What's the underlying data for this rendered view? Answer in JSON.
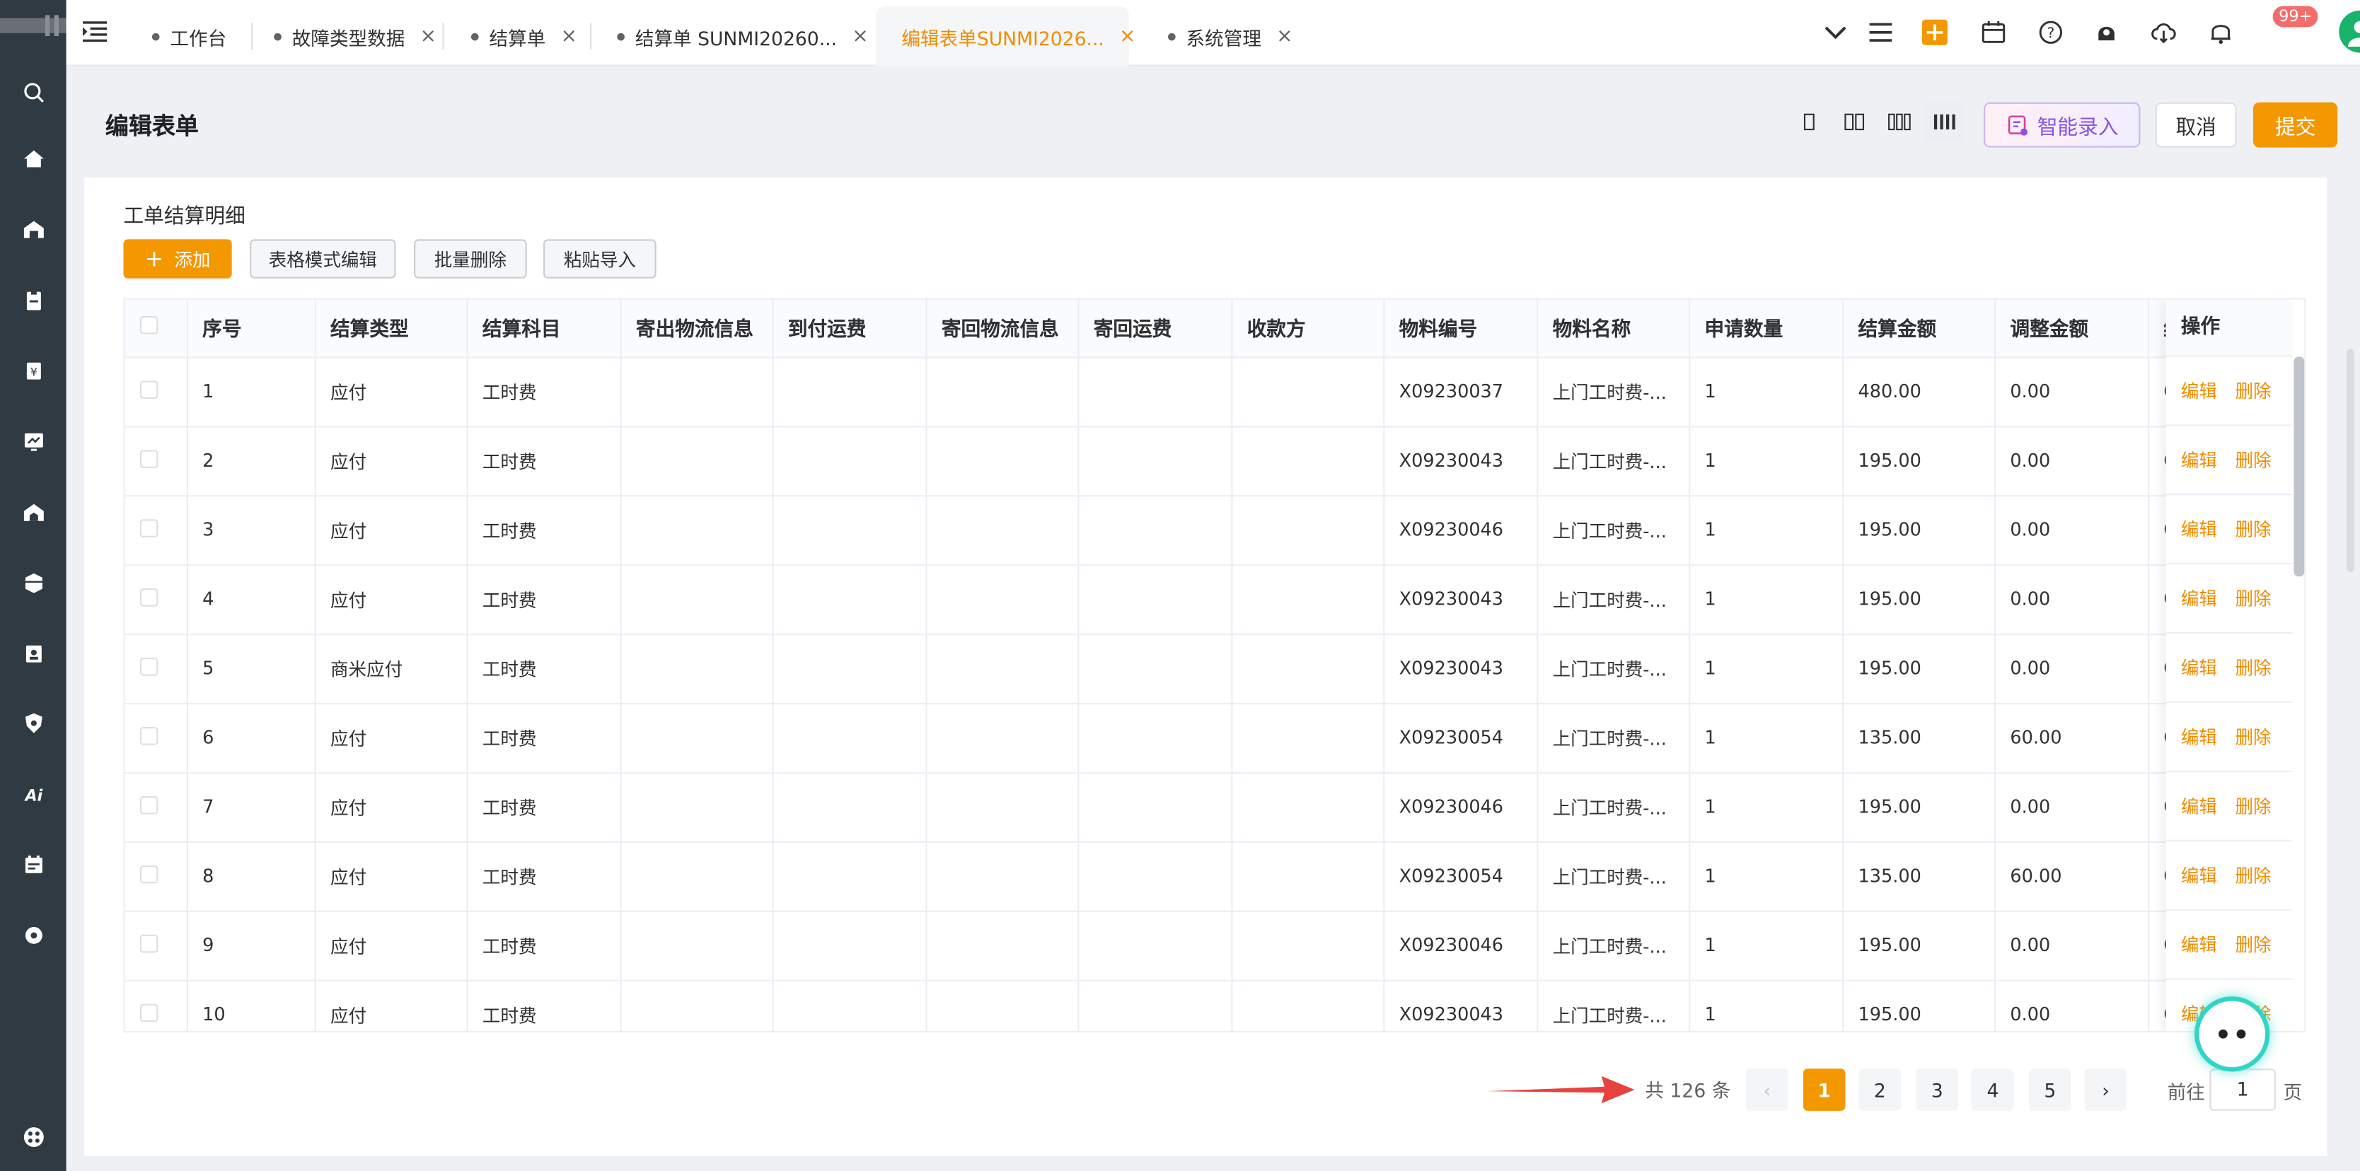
{
  "tabs": [
    {
      "label": "工作台",
      "closable": false
    },
    {
      "label": "故障类型数据",
      "closable": true
    },
    {
      "label": "结算单",
      "closable": true
    },
    {
      "label": "结算单 SUNMI20260...",
      "closable": true
    },
    {
      "label": "编辑表单SUNMI2026...",
      "closable": true,
      "active": true
    },
    {
      "label": "系统管理",
      "closable": true
    }
  ],
  "topbar": {
    "notification_badge": "99+",
    "icons": [
      "chevron-down-icon",
      "menu-lines-icon",
      "plus-square-icon",
      "calendar-icon",
      "help-icon",
      "bell-user-icon",
      "cloud-download-icon",
      "bell-icon",
      "user-avatar"
    ]
  },
  "header": {
    "title": "编辑表单",
    "ai_button": "智能录入",
    "cancel_button": "取消",
    "submit_button": "提交"
  },
  "section": {
    "title": "工单结算明细",
    "add_button": "添加",
    "table_mode_button": "表格模式编辑",
    "batch_delete_button": "批量删除",
    "paste_import_button": "粘贴导入"
  },
  "table": {
    "columns": [
      "序号",
      "结算类型",
      "结算科目",
      "寄出物流信息",
      "到付运费",
      "寄回物流信息",
      "寄回运费",
      "收款方",
      "物料编号",
      "物料名称",
      "申请数量",
      "结算金额",
      "调整金额",
      "结"
    ],
    "action_header": "操作",
    "action_edit": "编辑",
    "action_delete": "删除",
    "rows": [
      [
        "1",
        "应付",
        "工时费",
        "",
        "",
        "",
        "",
        "",
        "X09230037",
        "上门工时费-...",
        "1",
        "480.00",
        "0.00",
        "C"
      ],
      [
        "2",
        "应付",
        "工时费",
        "",
        "",
        "",
        "",
        "",
        "X09230043",
        "上门工时费-...",
        "1",
        "195.00",
        "0.00",
        "C"
      ],
      [
        "3",
        "应付",
        "工时费",
        "",
        "",
        "",
        "",
        "",
        "X09230046",
        "上门工时费-...",
        "1",
        "195.00",
        "0.00",
        "CN"
      ],
      [
        "4",
        "应付",
        "工时费",
        "",
        "",
        "",
        "",
        "",
        "X09230043",
        "上门工时费-...",
        "1",
        "195.00",
        "0.00",
        "CN"
      ],
      [
        "5",
        "商米应付",
        "工时费",
        "",
        "",
        "",
        "",
        "",
        "X09230043",
        "上门工时费-...",
        "1",
        "195.00",
        "0.00",
        "CN"
      ],
      [
        "6",
        "应付",
        "工时费",
        "",
        "",
        "",
        "",
        "",
        "X09230054",
        "上门工时费-...",
        "1",
        "135.00",
        "60.00",
        "C"
      ],
      [
        "7",
        "应付",
        "工时费",
        "",
        "",
        "",
        "",
        "",
        "X09230046",
        "上门工时费-...",
        "1",
        "195.00",
        "0.00",
        "C"
      ],
      [
        "8",
        "应付",
        "工时费",
        "",
        "",
        "",
        "",
        "",
        "X09230054",
        "上门工时费-...",
        "1",
        "135.00",
        "60.00",
        "C"
      ],
      [
        "9",
        "应付",
        "工时费",
        "",
        "",
        "",
        "",
        "",
        "X09230046",
        "上门工时费-...",
        "1",
        "195.00",
        "0.00",
        "C"
      ],
      [
        "10",
        "应付",
        "工时费",
        "",
        "",
        "",
        "",
        "",
        "X09230043",
        "上门工时费-...",
        "1",
        "195.00",
        "0.00",
        "C"
      ]
    ]
  },
  "pagination": {
    "total_text": "共 126 条",
    "pages": [
      "1",
      "2",
      "3",
      "4",
      "5"
    ],
    "current_page": "1",
    "prev": "‹",
    "next": "›",
    "goto_label": "前往",
    "goto_value": "1",
    "goto_unit": "页"
  },
  "colors": {
    "accent": "#f39800",
    "sidebar": "#2f3a43",
    "ai_ring": "#2fd6c6",
    "arrow": "#e8423f"
  }
}
